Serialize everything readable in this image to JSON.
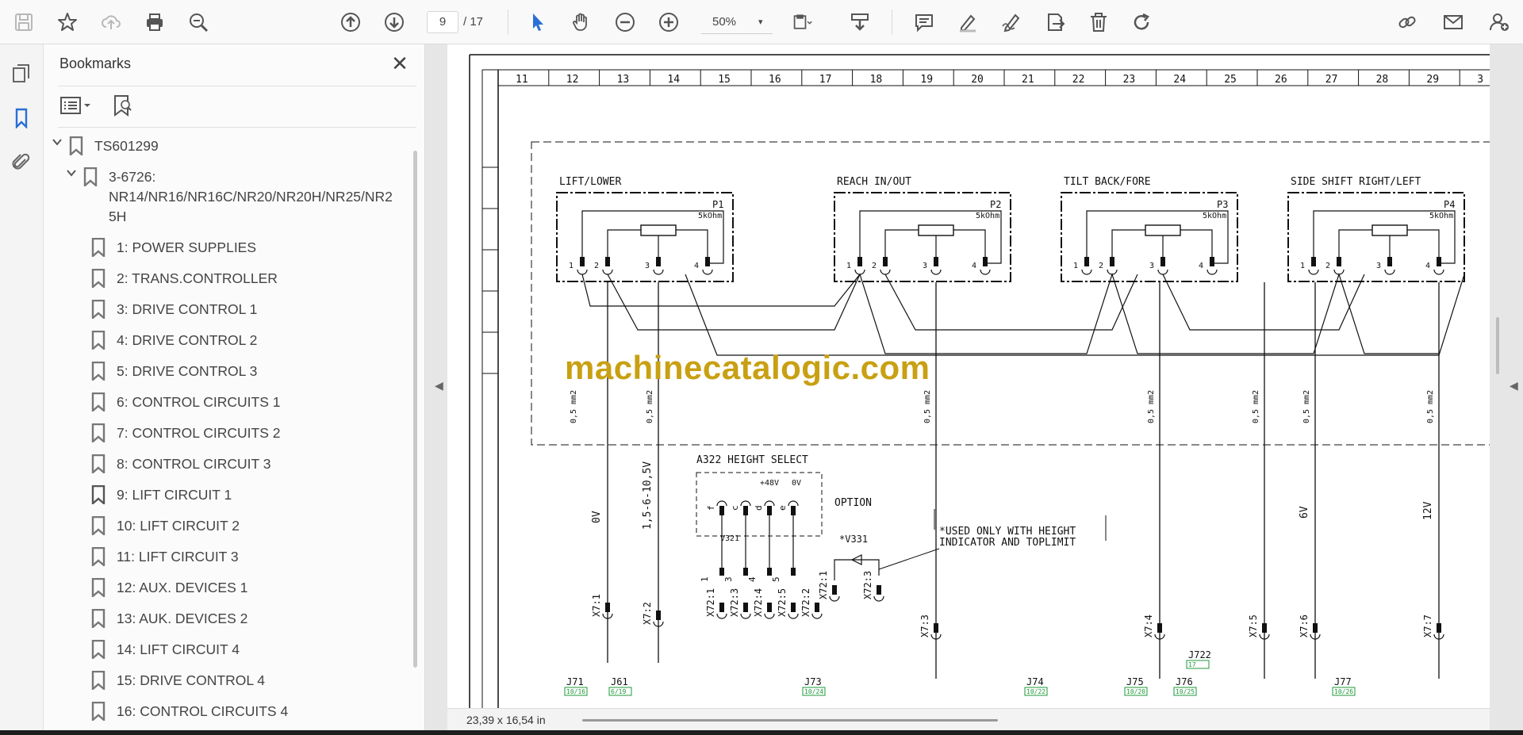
{
  "toolbar": {
    "page_current": "9",
    "page_total": "/ 17",
    "zoom": "50%",
    "zoom_caret": "▾"
  },
  "panel": {
    "title": "Bookmarks",
    "close_glyph": "✕"
  },
  "bookmarks": [
    {
      "label": "TS601299",
      "level": 0,
      "expanded": true
    },
    {
      "label": "3-6726: NR14/NR16/NR16C/NR20/NR20H/NR25/NR25H",
      "lines": [
        "3-6726:",
        "NR14/NR16/NR16C/NR20/NR20H/NR25/NR2",
        "5H"
      ],
      "level": 1,
      "expanded": true
    },
    {
      "label": "1: POWER SUPPLIES",
      "level": 2
    },
    {
      "label": "2: TRANS.CONTROLLER",
      "level": 2
    },
    {
      "label": "3: DRIVE CONTROL 1",
      "level": 2
    },
    {
      "label": "4: DRIVE CONTROL 2",
      "level": 2
    },
    {
      "label": "5: DRIVE CONTROL 3",
      "level": 2
    },
    {
      "label": "6: CONTROL CIRCUITS 1",
      "level": 2
    },
    {
      "label": "7: CONTROL CIRCUITS 2",
      "level": 2
    },
    {
      "label": "8: CONTROL CIRCUIT 3",
      "level": 2
    },
    {
      "label": "9: LIFT CIRCUIT 1",
      "level": 2,
      "current": true
    },
    {
      "label": "10: LIFT CIRCUIT 2",
      "level": 2
    },
    {
      "label": "11: LIFT CIRCUIT 3",
      "level": 2
    },
    {
      "label": "12: AUX. DEVICES 1",
      "level": 2
    },
    {
      "label": "13: AUK. DEVICES 2",
      "level": 2
    },
    {
      "label": "14: LIFT CIRCUIT 4",
      "level": 2
    },
    {
      "label": "15: DRIVE CONTROL 4",
      "level": 2
    },
    {
      "label": "16: CONTROL CIRCUITS 4",
      "level": 2
    }
  ],
  "document": {
    "watermark": "machinecatalogic.com",
    "dimensions": "23,39 x 16,54 in",
    "column_numbers": [
      "11",
      "12",
      "13",
      "14",
      "15",
      "16",
      "17",
      "18",
      "19",
      "20",
      "21",
      "22",
      "23",
      "24",
      "25",
      "26",
      "27",
      "28",
      "29",
      "3"
    ],
    "joysticks": [
      {
        "title": "LIFT/LOWER",
        "ref": "P1",
        "value": "5kOhm"
      },
      {
        "title": "REACH   IN/OUT",
        "ref": "P2",
        "value": "5kOhm"
      },
      {
        "title": "TILT      BACK/FORE",
        "ref": "P3",
        "value": "5kOhm"
      },
      {
        "title": "SIDE SHIFT RIGHT/LEFT",
        "ref": "P4",
        "value": "5kOhm"
      }
    ],
    "pin_numbers": [
      "1",
      "2",
      "3",
      "4"
    ],
    "wire_size": "0,5 mm2",
    "module_title": "A322    HEIGHT SELECT",
    "option_label": "OPTION",
    "module_supply": [
      "+48V",
      "0V"
    ],
    "module_pins": [
      "f",
      "c",
      "d",
      "e"
    ],
    "module_terminals": [
      "1",
      "3",
      "4",
      "5"
    ],
    "diode_v321": "V321",
    "diode_v331": "*V331",
    "note_line1": "*USED ONLY WITH HEIGHT",
    "note_line2": " INDICATOR AND TOPLIMIT",
    "voltage_0v": "0V",
    "voltage_range": "1,5-6-10,5V",
    "voltage_6v": "6V",
    "voltage_12v": "12V",
    "connectors": [
      "X7:1",
      "X7:2",
      "X72:1",
      "X72:3",
      "X72:4",
      "X72:5",
      "X72:2",
      "X72:1",
      "X72:3",
      "X7:3",
      "X7:4",
      "X7:5",
      "X7:6",
      "X7:7"
    ],
    "jumpers": [
      {
        "ref": "J71",
        "xref": "10/16"
      },
      {
        "ref": "J61",
        "xref": "6/19"
      },
      {
        "ref": "J73",
        "xref": "10/24"
      },
      {
        "ref": "J74",
        "xref": "10/22"
      },
      {
        "ref": "J75",
        "xref": "10/20"
      },
      {
        "ref": "J76",
        "xref": "10/25"
      },
      {
        "ref": "J77",
        "xref": "10/26"
      },
      {
        "ref": "J722",
        "xref": "17"
      }
    ]
  },
  "colors": {
    "accent_blue": "#2a6fd6",
    "watermark": "#c8a012",
    "xref_green": "#1e9a3a"
  },
  "icons": [
    "save-icon",
    "star-icon",
    "upload-icon",
    "print-icon",
    "search-zoom-icon",
    "arrow-up-icon",
    "arrow-down-icon",
    "select-cursor-icon",
    "hand-icon",
    "zoom-out-icon",
    "zoom-in-icon",
    "fit-page-icon",
    "scroll-mode-icon",
    "comment-icon",
    "highlight-icon",
    "sign-icon",
    "share-icon",
    "delete-icon",
    "rotate-icon",
    "link-icon",
    "email-icon",
    "user-add-icon"
  ]
}
